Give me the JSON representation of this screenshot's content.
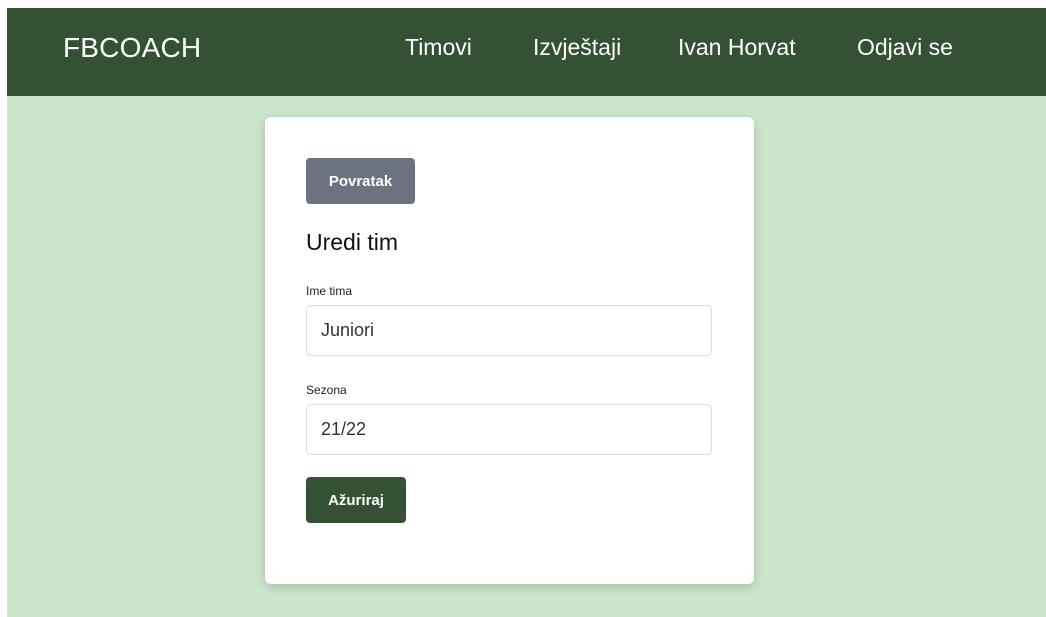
{
  "navbar": {
    "brand": "FBCOACH",
    "links": [
      {
        "label": "Timovi"
      },
      {
        "label": "Izvještaji"
      },
      {
        "label": "Ivan Horvat"
      },
      {
        "label": "Odjavi se"
      }
    ]
  },
  "form": {
    "back_label": "Povratak",
    "title": "Uredi tim",
    "team_name_label": "Ime tima",
    "team_name_value": "Juniori",
    "season_label": "Sezona",
    "season_value": "21/22",
    "submit_label": "Ažuriraj"
  },
  "colors": {
    "navbar_bg": "#345134",
    "page_bg": "#cbe6cb",
    "back_button": "#6c7280",
    "submit_button": "#345134"
  }
}
